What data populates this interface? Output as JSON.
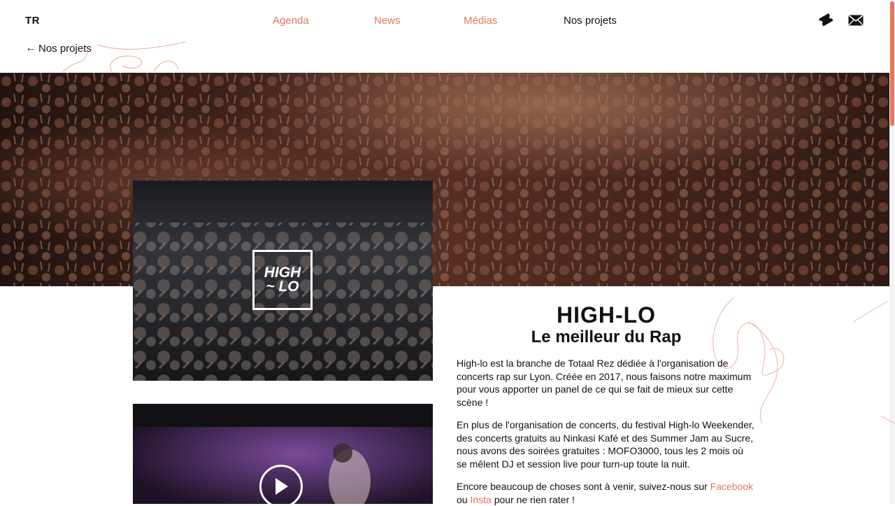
{
  "brand": {
    "logo": "TR"
  },
  "nav": {
    "items": [
      {
        "label": "Agenda"
      },
      {
        "label": "News"
      },
      {
        "label": "Médias"
      },
      {
        "label": "Nos projets"
      }
    ]
  },
  "header_icons": {
    "tickets": "ticket-icon",
    "contact": "envelope-icon"
  },
  "back_link": {
    "arrow": "←",
    "label": "Nos projets"
  },
  "project": {
    "logo_line1": "HIGH",
    "logo_line2": "~ LO",
    "title": "HIGH-LO",
    "subtitle": "Le meilleur du Rap",
    "paragraph1": "High-lo est la branche de Totaal Rez dédiée à l'organisation de concerts rap sur Lyon. Créée en 2017, nous faisons notre maximum pour vous apporter un panel de ce qui se fait de mieux sur cette scène !",
    "paragraph2": "En plus de l'organisation de concerts, du festival High-lo Weekender, des concerts gratuits au Ninkasi Kafé et des Summer Jam au Sucre, nous avons des soirées gratuites : MOFO3000, tous les 2 mois où se mêlent DJ et session live pour turn-up toute la nuit.",
    "paragraph3_prefix": "Encore beaucoup de choses sont à venir, suivez-nous sur ",
    "facebook_link": "Facebook",
    "paragraph3_line2_prefix": "ou ",
    "insta_link": "Insta",
    "paragraph3_suffix": " pour ne rien rater !"
  },
  "video": {
    "play_icon": "play-icon"
  },
  "colors": {
    "accent": "#e2785e",
    "text": "#111111",
    "background": "#ffffff"
  }
}
